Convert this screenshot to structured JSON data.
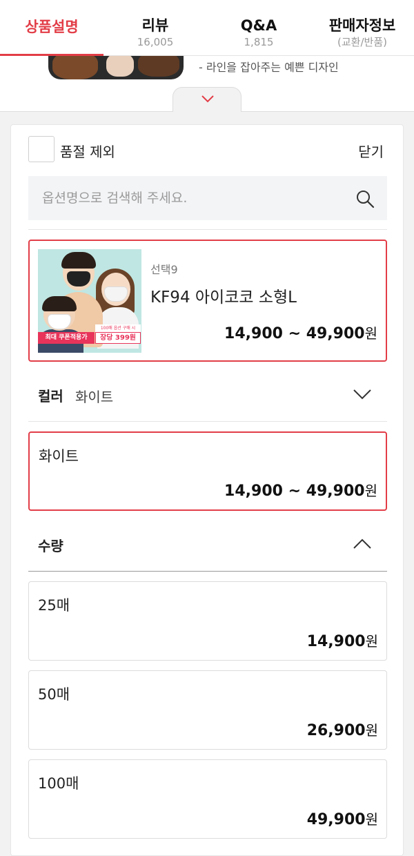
{
  "tabs": [
    {
      "label": "상품설명",
      "count": ""
    },
    {
      "label": "리뷰",
      "count": "16,005"
    },
    {
      "label": "Q&A",
      "count": "1,815"
    },
    {
      "label": "판매자정보",
      "count": "(교환/반품)"
    }
  ],
  "description_peek": {
    "caption": "- 라인을 잡아주는 예쁜 디자인"
  },
  "options": {
    "exclude_soldout_label": "품절 제외",
    "close_label": "닫기",
    "search_placeholder": "옵션명으로 검색해 주세요.",
    "selected_product": {
      "subtitle": "선택9",
      "title": "KF94 아이코코 소형L",
      "price_range": "14,900 ~ 49,900",
      "currency": "원",
      "thumbnail": {
        "badge_left": "최대 쿠폰적용가",
        "badge_right": "장당 399원",
        "badge_top": "100매 옵션 구매 시"
      }
    },
    "color": {
      "label": "컬러",
      "value": "화이트",
      "choice": {
        "name": "화이트",
        "price_range": "14,900 ~ 49,900",
        "currency": "원"
      }
    },
    "quantity": {
      "label": "수량",
      "choices": [
        {
          "name": "25매",
          "price": "14,900",
          "currency": "원"
        },
        {
          "name": "50매",
          "price": "26,900",
          "currency": "원"
        },
        {
          "name": "100매",
          "price": "49,900",
          "currency": "원"
        }
      ]
    }
  },
  "colors": {
    "accent": "#e23d47",
    "badge_pink": "#e8345a"
  }
}
